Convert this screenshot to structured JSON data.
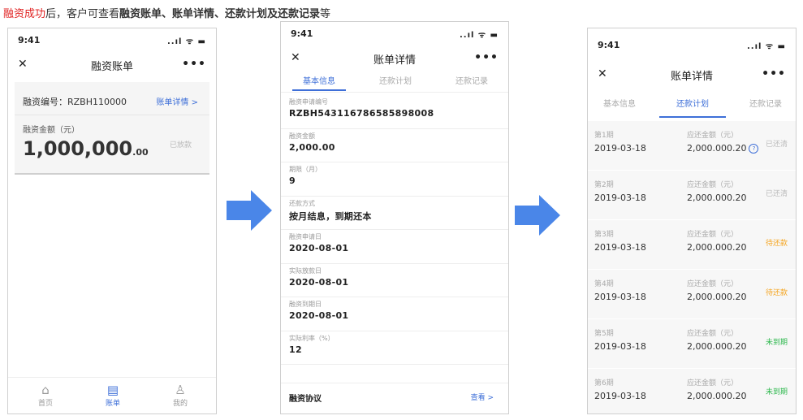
{
  "caption": {
    "part1": "融资成功",
    "part2": "后，客户可查看",
    "part3": "融资账单、账单详情、还款计划及还款记录",
    "part4": "等"
  },
  "colors": {
    "accent": "#3e6fd8",
    "red": "#e02020",
    "pending": "#f5a623",
    "not_due": "#2db84d",
    "paid": "#bbbbbb",
    "arrow": "#4a86e8"
  },
  "phone1": {
    "time": "9:41",
    "signal": "..ıl ᯤ ▬",
    "close": "✕",
    "title": "融资账单",
    "more": "•••",
    "finance_no": "融资编号：RZBH110000",
    "detail_link": "账单详情 >",
    "amount_label": "融资金额（元）",
    "amount": "1,000,000",
    "amount_decimals": ".00",
    "status": "已放款",
    "tabbar": [
      {
        "icon": "⌂",
        "label": "首页"
      },
      {
        "icon": "▤",
        "label": "账单"
      },
      {
        "icon": "♙",
        "label": "我的"
      }
    ]
  },
  "phone2": {
    "time": "9:41",
    "signal": "..ıl ᯤ ▬",
    "close": "✕",
    "title": "账单详情",
    "more": "•••",
    "tabs": [
      "基本信息",
      "还款计划",
      "还款记录"
    ],
    "fields": [
      {
        "label": "融资申请编号",
        "value": "RZBH543116786585898008"
      },
      {
        "label": "融资金额",
        "value": "2,000.00"
      },
      {
        "label": "期限（月）",
        "value": "9"
      },
      {
        "label": "还款方式",
        "value": "按月结息，到期还本"
      },
      {
        "label": "融资申请日",
        "value": "2020-08-01"
      },
      {
        "label": "实际放款日",
        "value": "2020-08-01"
      },
      {
        "label": "融资到期日",
        "value": "2020-08-01"
      },
      {
        "label": "实际利率（%）",
        "value": "12"
      }
    ],
    "agreement": "融资协议",
    "view_link": "查看 >"
  },
  "phone3": {
    "time": "9:41",
    "signal": "..ıl ᯤ ▬",
    "close": "✕",
    "title": "账单详情",
    "more": "•••",
    "tabs": [
      "基本信息",
      "还款计划",
      "还款记录"
    ],
    "due_label": "应还金额（元）",
    "info_icon": "?",
    "rows": [
      {
        "period": "第1期",
        "date": "2019-03-18",
        "amount": "2,000.000.20",
        "status": "已还清",
        "status_color": "#bbbbbb"
      },
      {
        "period": "第2期",
        "date": "2019-03-18",
        "amount": "2,000.000.20",
        "status": "已还清",
        "status_color": "#bbbbbb"
      },
      {
        "period": "第3期",
        "date": "2019-03-18",
        "amount": "2,000.000.20",
        "status": "待还款",
        "status_color": "#f5a623"
      },
      {
        "period": "第4期",
        "date": "2019-03-18",
        "amount": "2,000.000.20",
        "status": "待还款",
        "status_color": "#f5a623"
      },
      {
        "period": "第5期",
        "date": "2019-03-18",
        "amount": "2,000.000.20",
        "status": "未到期",
        "status_color": "#2db84d"
      },
      {
        "period": "第6期",
        "date": "2019-03-18",
        "amount": "2,000.000.20",
        "status": "未到期",
        "status_color": "#2db84d"
      }
    ]
  }
}
